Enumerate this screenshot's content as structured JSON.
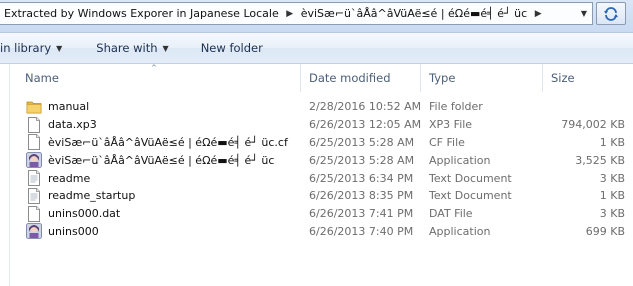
{
  "address_bar": {
    "crumbs": [
      "Extracted by Windows Exporer in Japanese Locale",
      "èviSæ⌐ü`âÅâ^âVüAë≤é | éΩé▬é╡ é┘ üc"
    ]
  },
  "toolbar": {
    "include_label": "in library",
    "share_label": "Share with",
    "new_folder_label": "New folder"
  },
  "columns": {
    "name": "Name",
    "date": "Date modified",
    "type": "Type",
    "size": "Size"
  },
  "files": [
    {
      "icon": "folder-icon",
      "name": "manual",
      "date": "2/28/2016 10:52 AM",
      "type": "File folder",
      "size": ""
    },
    {
      "icon": "file-icon",
      "name": "data.xp3",
      "date": "6/26/2013 12:05 AM",
      "type": "XP3 File",
      "size": "794,002 KB"
    },
    {
      "icon": "file-icon",
      "name": "èviSæ⌐ü`âÅâ^âVüAë≤é | éΩé▬é╡ é┘ üc.cf",
      "date": "6/25/2013 5:28 AM",
      "type": "CF File",
      "size": "1 KB"
    },
    {
      "icon": "app-icon",
      "name": "èviSæ⌐ü`âÅâ^âVüAë≤é | éΩé▬é╡ é┘ üc",
      "date": "6/25/2013 5:28 AM",
      "type": "Application",
      "size": "3,525 KB"
    },
    {
      "icon": "text-doc-icon",
      "name": "readme",
      "date": "6/25/2013 6:34 PM",
      "type": "Text Document",
      "size": "3 KB"
    },
    {
      "icon": "text-doc-icon",
      "name": "readme_startup",
      "date": "6/26/2013 8:35 PM",
      "type": "Text Document",
      "size": "1 KB"
    },
    {
      "icon": "file-icon",
      "name": "unins000.dat",
      "date": "6/26/2013 7:41 PM",
      "type": "DAT File",
      "size": "3 KB"
    },
    {
      "icon": "app-icon",
      "name": "unins000",
      "date": "6/26/2013 7:40 PM",
      "type": "Application",
      "size": "699 KB"
    }
  ]
}
